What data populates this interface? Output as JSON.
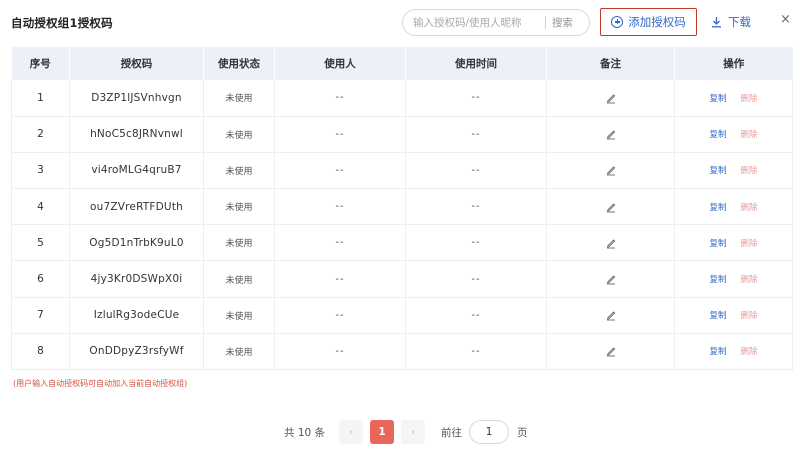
{
  "header": {
    "title": "自动授权组1授权码",
    "search_placeholder": "输入授权码/使用人昵称",
    "search_button": "搜索",
    "add_button": "添加授权码",
    "download_button": "下载",
    "close": "×"
  },
  "table": {
    "columns": [
      "序号",
      "授权码",
      "使用状态",
      "使用人",
      "使用时间",
      "备注",
      "操作"
    ],
    "rows": [
      {
        "no": "1",
        "code": "D3ZP1lJSVnhvgn",
        "status": "未使用",
        "user": "--",
        "time": "--"
      },
      {
        "no": "2",
        "code": "hNoC5c8JRNvnwl",
        "status": "未使用",
        "user": "--",
        "time": "--"
      },
      {
        "no": "3",
        "code": "vi4roMLG4qruB7",
        "status": "未使用",
        "user": "--",
        "time": "--"
      },
      {
        "no": "4",
        "code": "ou7ZVreRTFDUth",
        "status": "未使用",
        "user": "--",
        "time": "--"
      },
      {
        "no": "5",
        "code": "Og5D1nTrbK9uL0",
        "status": "未使用",
        "user": "--",
        "time": "--"
      },
      {
        "no": "6",
        "code": "4jy3Kr0DSWpX0i",
        "status": "未使用",
        "user": "--",
        "time": "--"
      },
      {
        "no": "7",
        "code": "IzlulRg3odeCUe",
        "status": "未使用",
        "user": "--",
        "time": "--"
      },
      {
        "no": "8",
        "code": "OnDDpyZ3rsfyWf",
        "status": "未使用",
        "user": "--",
        "time": "--"
      }
    ],
    "actions": {
      "copy": "复制",
      "delete": "删除"
    }
  },
  "note": "(用户输入自动授权码可自动加入当前自动授权组)",
  "pagination": {
    "total": "共 10 条",
    "prev": "‹",
    "current_page": "1",
    "next": "›",
    "goto_label": "前往",
    "goto_value": "1",
    "page_unit": "页"
  },
  "colors": {
    "accent_blue": "#3469c8",
    "highlight_red": "#c5372a",
    "active_page": "#e8665a",
    "header_bg": "#edf0f6"
  }
}
